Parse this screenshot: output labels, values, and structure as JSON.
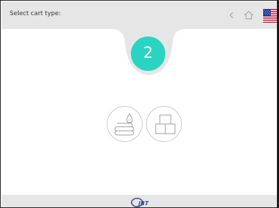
{
  "header": {
    "title": "Select cart type:",
    "back_icon": "chevron-left-icon",
    "home_icon": "home-icon",
    "language_flag": "us-flag"
  },
  "step": {
    "number": "2",
    "color": "#2ad4c2"
  },
  "options": [
    {
      "name": "blanket-cart-option",
      "icon": "folded-blanket-icon"
    },
    {
      "name": "bin-cart-option",
      "icon": "stacked-bins-icon"
    }
  ],
  "footer": {
    "logo_text": "JBT"
  },
  "colors": {
    "header_bg": "#e6e6e6",
    "accent": "#2ad4c2",
    "icon_stroke": "#9a9a9a"
  }
}
